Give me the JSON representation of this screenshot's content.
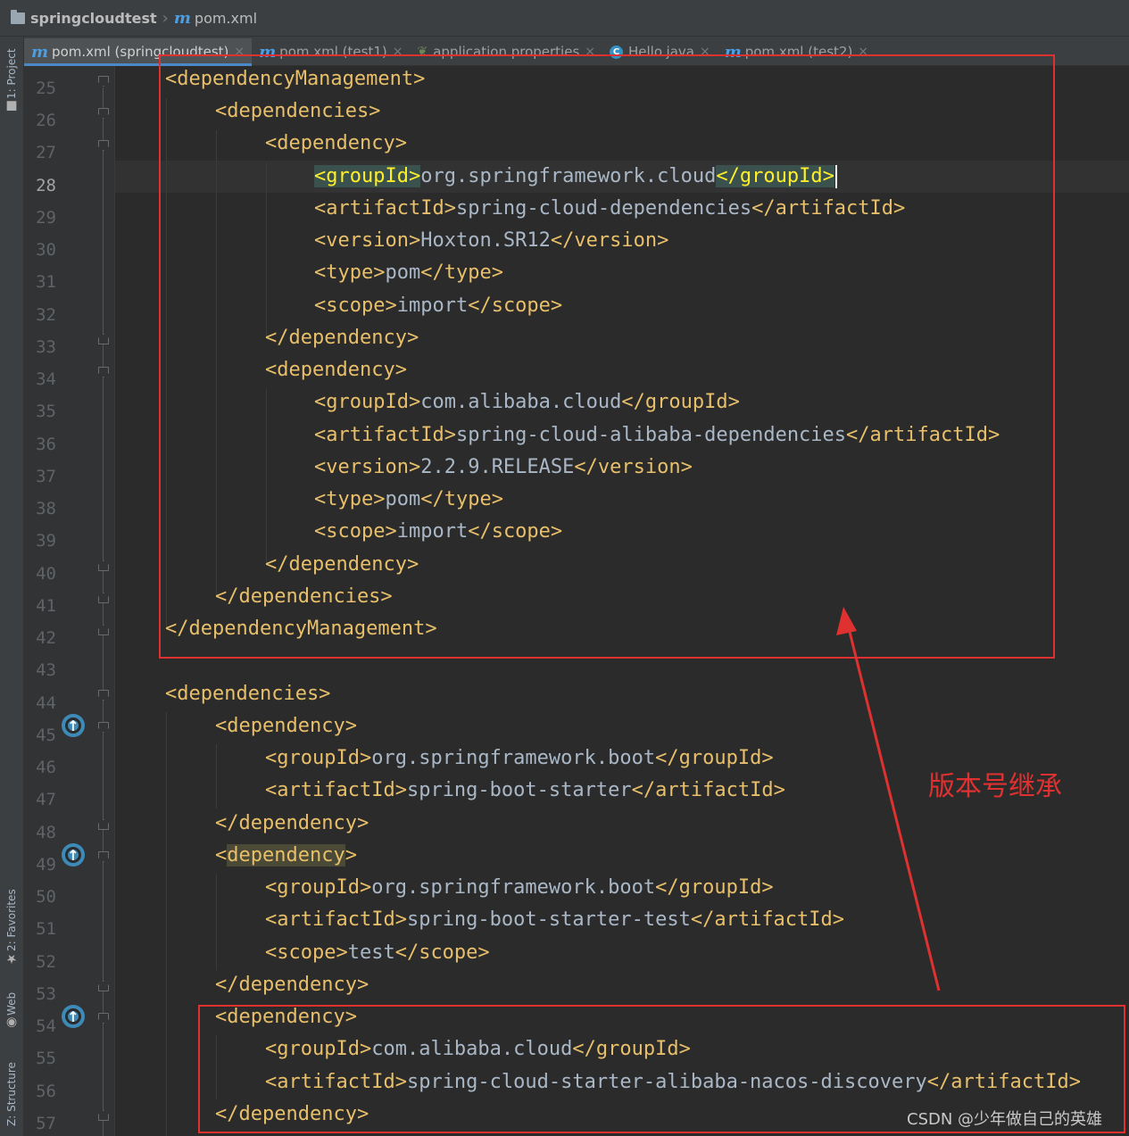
{
  "breadcrumb": {
    "project": "springcloudtest",
    "file": "pom.xml"
  },
  "tool_windows": {
    "project": "1: Project",
    "favorites": "2: Favorites",
    "web": "Web",
    "structure": "Z: Structure"
  },
  "tabs": [
    {
      "label": "pom.xml (springcloudtest)",
      "icon": "maven-icon",
      "active": true
    },
    {
      "label": "pom.xml (test1)",
      "icon": "maven-icon",
      "active": false
    },
    {
      "label": "application.properties",
      "icon": "spring-leaf-icon",
      "active": false
    },
    {
      "label": "Hello.java",
      "icon": "java-class-icon",
      "active": false
    },
    {
      "label": "pom.xml (test2)",
      "icon": "maven-icon",
      "active": false
    }
  ],
  "tab_close_glyph": "×",
  "line_numbers": [
    "25",
    "26",
    "27",
    "28",
    "29",
    "30",
    "31",
    "32",
    "33",
    "34",
    "35",
    "36",
    "37",
    "38",
    "39",
    "40",
    "41",
    "42",
    "43",
    "44",
    "45",
    "46",
    "47",
    "48",
    "49",
    "50",
    "51",
    "52",
    "53",
    "54",
    "55",
    "56",
    "57"
  ],
  "current_line": "28",
  "code": {
    "l25": {
      "tag": "<dependencyManagement>"
    },
    "l26": {
      "tag": "<dependencies>"
    },
    "l27": {
      "tag": "<dependency>"
    },
    "l28": {
      "open": "groupId",
      "value": "org.springframework.cloud",
      "close": "groupId"
    },
    "l29": {
      "open": "<artifactId>",
      "value": "spring-cloud-dependencies",
      "close": "</artifactId>"
    },
    "l30": {
      "open": "<version>",
      "value": "Hoxton.SR12",
      "close": "</version>"
    },
    "l31": {
      "open": "<type>",
      "value": "pom",
      "close": "</type>"
    },
    "l32": {
      "open": "<scope>",
      "value": "import",
      "close": "</scope>"
    },
    "l33": {
      "tag": "</dependency>"
    },
    "l34": {
      "tag": "<dependency>"
    },
    "l35": {
      "open": "<groupId>",
      "value": "com.alibaba.cloud",
      "close": "</groupId>"
    },
    "l36": {
      "open": "<artifactId>",
      "value": "spring-cloud-alibaba-dependencies",
      "close": "</artifactId>"
    },
    "l37": {
      "open": "<version>",
      "value": "2.2.9.RELEASE",
      "close": "</version>"
    },
    "l38": {
      "open": "<type>",
      "value": "pom",
      "close": "</type>"
    },
    "l39": {
      "open": "<scope>",
      "value": "import",
      "close": "</scope>"
    },
    "l40": {
      "tag": "</dependency>"
    },
    "l41": {
      "tag": "</dependencies>"
    },
    "l42": {
      "tag": "</dependencyManagement>"
    },
    "l44": {
      "tag": "<dependencies>"
    },
    "l45": {
      "tag": "<dependency>"
    },
    "l46": {
      "open": "<groupId>",
      "value": "org.springframework.boot",
      "close": "</groupId>"
    },
    "l47": {
      "open": "<artifactId>",
      "value": "spring-boot-starter",
      "close": "</artifactId>"
    },
    "l48": {
      "tag": "</dependency>"
    },
    "l49": {
      "lt": "<",
      "name": "dependency",
      "gt": ">"
    },
    "l50": {
      "open": "<groupId>",
      "value": "org.springframework.boot",
      "close": "</groupId>"
    },
    "l51": {
      "open": "<artifactId>",
      "value": "spring-boot-starter-test",
      "close": "</artifactId>"
    },
    "l52": {
      "open": "<scope>",
      "value": "test",
      "close": "</scope>"
    },
    "l53": {
      "tag": "</dependency>"
    },
    "l54": {
      "tag": "<dependency>"
    },
    "l55": {
      "open": "<groupId>",
      "value": "com.alibaba.cloud",
      "close": "</groupId>"
    },
    "l56": {
      "open": "<artifactId>",
      "value": "spring-cloud-starter-alibaba-nacos-discovery",
      "close": "</artifactId>"
    },
    "l57": {
      "tag": "</dependency>"
    }
  },
  "annotation": {
    "label": "版本号继承",
    "color": "#e03131"
  },
  "watermark": "CSDN @少年做自己的英雄",
  "colors": {
    "editor_bg": "#2b2b2b",
    "tag": "#e8bf6a",
    "text": "#a9b7c6",
    "match_highlight": "#3b514d"
  }
}
